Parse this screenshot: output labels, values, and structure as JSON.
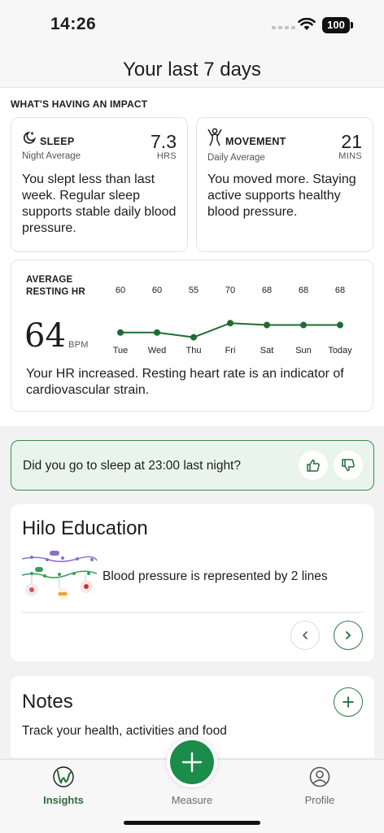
{
  "status_bar": {
    "time": "14:26",
    "battery": "100"
  },
  "header": {
    "title": "Your last 7 days"
  },
  "impact": {
    "section_title": "WHAT'S HAVING AN IMPACT",
    "sleep": {
      "icon": "moon-sparkle-icon",
      "name": "SLEEP",
      "sub": "Night Average",
      "value": "7.3",
      "unit": "HRS",
      "description": "You slept less than last week. Regular sleep supports stable daily blood pressure."
    },
    "movement": {
      "icon": "person-jumping-icon",
      "name": "MOVEMENT",
      "sub": "Daily Average",
      "value": "21",
      "unit": "MINS",
      "description": "You moved more. Staying active supports healthy blood pressure."
    },
    "resting_hr": {
      "label_line1": "AVERAGE",
      "label_line2": "RESTING HR",
      "value": "64",
      "unit": "BPM",
      "description": "Your HR increased. Resting heart rate is an indicator of cardiovascular strain."
    }
  },
  "chart_data": {
    "type": "line",
    "categories": [
      "Tue",
      "Wed",
      "Thu",
      "Fri",
      "Sat",
      "Sun",
      "Today"
    ],
    "values": [
      60,
      60,
      55,
      70,
      68,
      68,
      68
    ],
    "series_color": "#1f6b35",
    "grid": false
  },
  "question": {
    "text": "Did you go to sleep at 23:00 last night?",
    "thumbs_up_icon": "thumbs-up-icon",
    "thumbs_down_icon": "thumbs-down-icon"
  },
  "education": {
    "title": "Hilo Education",
    "item_text": "Blood pressure is represented by 2 lines"
  },
  "notes": {
    "title": "Notes",
    "subtitle": "Track your health, activities and food"
  },
  "tabs": [
    {
      "label": "Insights",
      "icon": "insights-logo-icon",
      "active": true
    },
    {
      "label": "Measure",
      "icon": "plus-icon",
      "active": false
    },
    {
      "label": "Profile",
      "icon": "profile-icon",
      "active": false
    }
  ],
  "colors": {
    "accent": "#2f6d3f",
    "brand_green": "#1a8d4a",
    "question_bg": "#e9f5ec"
  }
}
